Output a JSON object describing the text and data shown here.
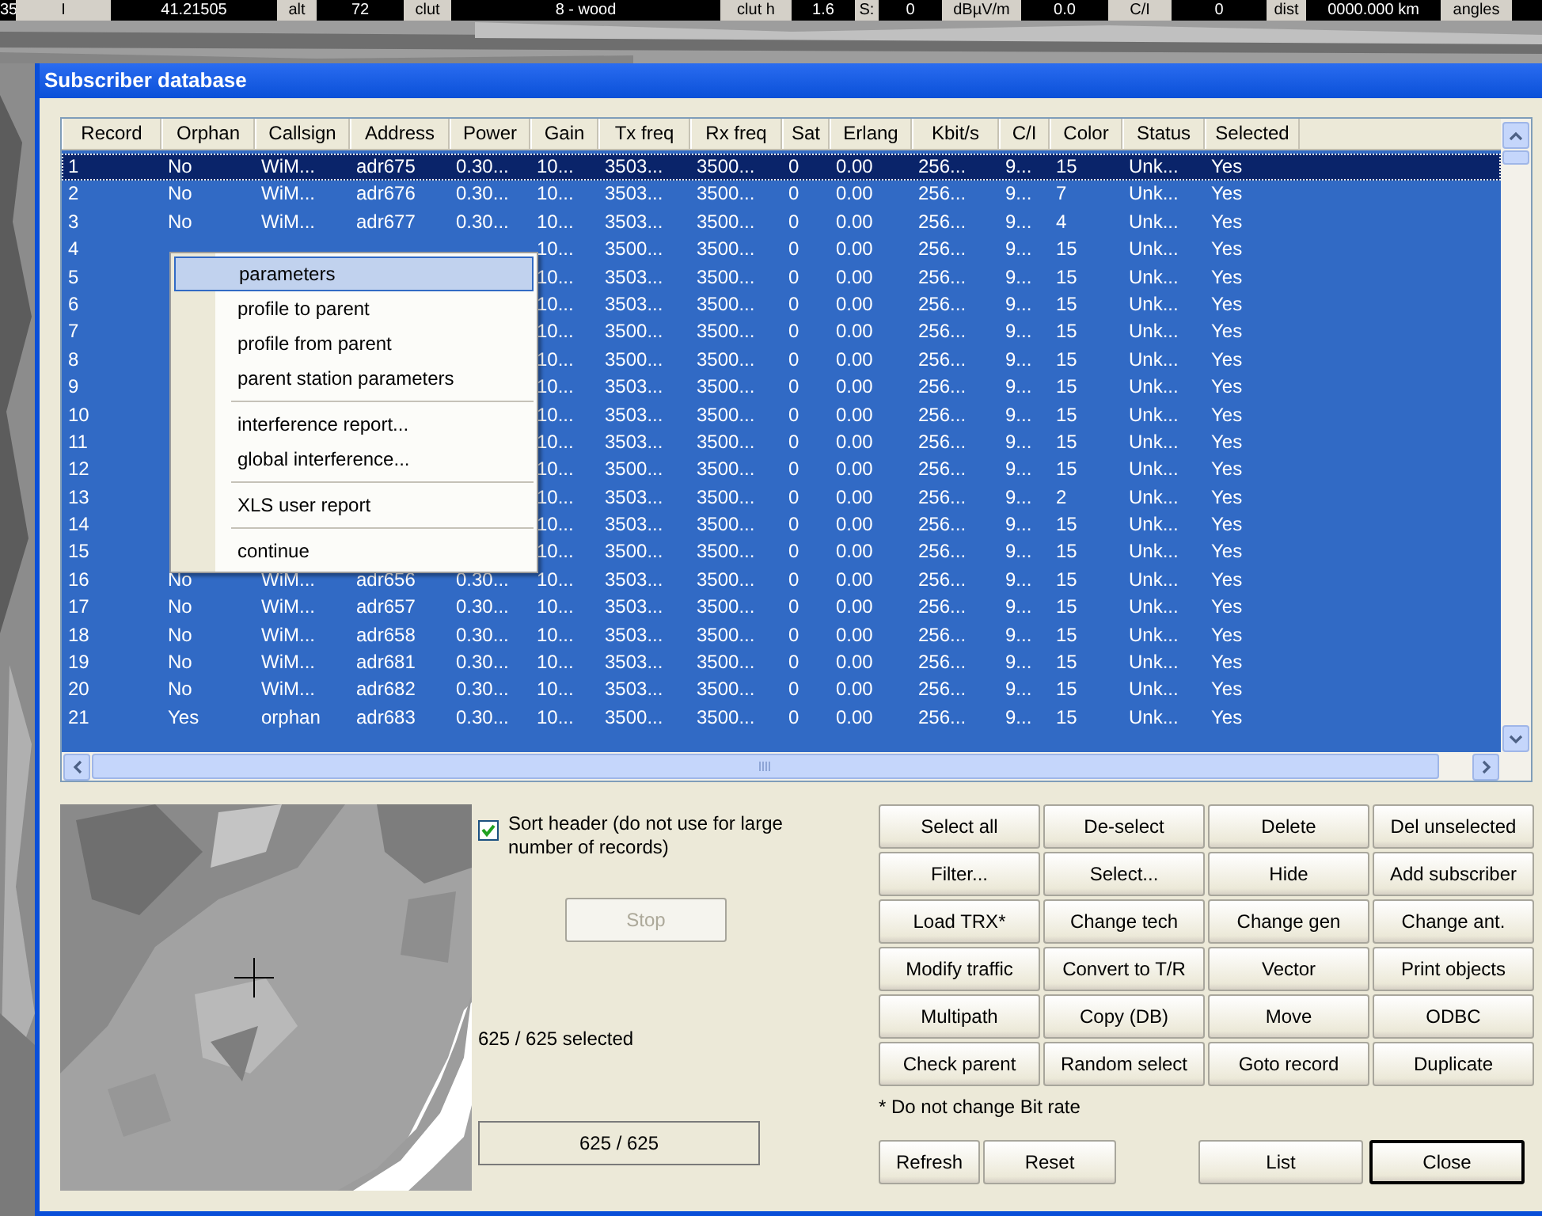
{
  "status_strip": [
    {
      "kind": "value",
      "text": "35"
    },
    {
      "kind": "label",
      "text": "I"
    },
    {
      "kind": "value",
      "text": "41.21505"
    },
    {
      "kind": "label",
      "text": "alt"
    },
    {
      "kind": "value",
      "text": "72"
    },
    {
      "kind": "label",
      "text": "clut"
    },
    {
      "kind": "value",
      "text": "8 - wood"
    },
    {
      "kind": "label",
      "text": "clut h"
    },
    {
      "kind": "value",
      "text": "1.6"
    },
    {
      "kind": "label",
      "text": "S:"
    },
    {
      "kind": "value",
      "text": "0"
    },
    {
      "kind": "label",
      "text": "dBµV/m"
    },
    {
      "kind": "value",
      "text": "0.0"
    },
    {
      "kind": "label",
      "text": "C/I"
    },
    {
      "kind": "value",
      "text": "0"
    },
    {
      "kind": "label",
      "text": "dist"
    },
    {
      "kind": "value",
      "text": "0000.000 km"
    },
    {
      "kind": "label",
      "text": "angles"
    }
  ],
  "window": {
    "title": "Subscriber database"
  },
  "table": {
    "columns": [
      "Record",
      "Orphan",
      "Callsign",
      "Address",
      "Power",
      "Gain",
      "Tx freq",
      "Rx freq",
      "Sat",
      "Erlang",
      "Kbit/s",
      "C/I",
      "Color",
      "Status",
      "Selected"
    ],
    "rows": [
      {
        "focused": true,
        "selected": true,
        "cells": [
          "1",
          "No",
          "WiM...",
          "adr675",
          "0.30...",
          "10...",
          "3503...",
          "3500...",
          "0",
          "0.00",
          "256...",
          "9...",
          "15",
          "Unk...",
          "Yes"
        ]
      },
      {
        "focused": false,
        "selected": true,
        "cells": [
          "2",
          "No",
          "WiM...",
          "adr676",
          "0.30...",
          "10...",
          "3503...",
          "3500...",
          "0",
          "0.00",
          "256...",
          "9...",
          "7",
          "Unk...",
          "Yes"
        ]
      },
      {
        "focused": false,
        "selected": true,
        "cells": [
          "3",
          "No",
          "WiM...",
          "adr677",
          "0.30...",
          "10...",
          "3503...",
          "3500...",
          "0",
          "0.00",
          "256...",
          "9...",
          "4",
          "Unk...",
          "Yes"
        ]
      },
      {
        "focused": false,
        "selected": true,
        "cells": [
          "4",
          null,
          null,
          null,
          null,
          "10...",
          "3500...",
          "3500...",
          "0",
          "0.00",
          "256...",
          "9...",
          "15",
          "Unk...",
          "Yes"
        ]
      },
      {
        "focused": false,
        "selected": true,
        "cells": [
          "5",
          null,
          null,
          null,
          null,
          "10...",
          "3503...",
          "3500...",
          "0",
          "0.00",
          "256...",
          "9...",
          "15",
          "Unk...",
          "Yes"
        ]
      },
      {
        "focused": false,
        "selected": true,
        "cells": [
          "6",
          null,
          null,
          null,
          null,
          "10...",
          "3503...",
          "3500...",
          "0",
          "0.00",
          "256...",
          "9...",
          "15",
          "Unk...",
          "Yes"
        ]
      },
      {
        "focused": false,
        "selected": true,
        "cells": [
          "7",
          null,
          null,
          null,
          null,
          "10...",
          "3500...",
          "3500...",
          "0",
          "0.00",
          "256...",
          "9...",
          "15",
          "Unk...",
          "Yes"
        ]
      },
      {
        "focused": false,
        "selected": true,
        "cells": [
          "8",
          null,
          null,
          null,
          null,
          "10...",
          "3500...",
          "3500...",
          "0",
          "0.00",
          "256...",
          "9...",
          "15",
          "Unk...",
          "Yes"
        ]
      },
      {
        "focused": false,
        "selected": true,
        "cells": [
          "9",
          null,
          null,
          null,
          null,
          "10...",
          "3503...",
          "3500...",
          "0",
          "0.00",
          "256...",
          "9...",
          "15",
          "Unk...",
          "Yes"
        ]
      },
      {
        "focused": false,
        "selected": true,
        "cells": [
          "10",
          null,
          null,
          null,
          null,
          "10...",
          "3503...",
          "3500...",
          "0",
          "0.00",
          "256...",
          "9...",
          "15",
          "Unk...",
          "Yes"
        ]
      },
      {
        "focused": false,
        "selected": true,
        "cells": [
          "11",
          null,
          null,
          null,
          null,
          "10...",
          "3503...",
          "3500...",
          "0",
          "0.00",
          "256...",
          "9...",
          "15",
          "Unk...",
          "Yes"
        ]
      },
      {
        "focused": false,
        "selected": true,
        "cells": [
          "12",
          null,
          null,
          null,
          null,
          "10...",
          "3500...",
          "3500...",
          "0",
          "0.00",
          "256...",
          "9...",
          "15",
          "Unk...",
          "Yes"
        ]
      },
      {
        "focused": false,
        "selected": true,
        "cells": [
          "13",
          null,
          null,
          null,
          null,
          "10...",
          "3503...",
          "3500...",
          "0",
          "0.00",
          "256...",
          "9...",
          "2",
          "Unk...",
          "Yes"
        ]
      },
      {
        "focused": false,
        "selected": true,
        "cells": [
          "14",
          null,
          null,
          null,
          null,
          "10...",
          "3503...",
          "3500...",
          "0",
          "0.00",
          "256...",
          "9...",
          "15",
          "Unk...",
          "Yes"
        ]
      },
      {
        "focused": false,
        "selected": true,
        "cells": [
          "15",
          null,
          null,
          null,
          null,
          "10...",
          "3500...",
          "3500...",
          "0",
          "0.00",
          "256...",
          "9...",
          "15",
          "Unk...",
          "Yes"
        ]
      },
      {
        "focused": false,
        "selected": true,
        "cells": [
          "16",
          "No",
          "WiM...",
          "adr656",
          "0.30...",
          "10...",
          "3503...",
          "3500...",
          "0",
          "0.00",
          "256...",
          "9...",
          "15",
          "Unk...",
          "Yes"
        ]
      },
      {
        "focused": false,
        "selected": true,
        "cells": [
          "17",
          "No",
          "WiM...",
          "adr657",
          "0.30...",
          "10...",
          "3503...",
          "3500...",
          "0",
          "0.00",
          "256...",
          "9...",
          "15",
          "Unk...",
          "Yes"
        ]
      },
      {
        "focused": false,
        "selected": true,
        "cells": [
          "18",
          "No",
          "WiM...",
          "adr658",
          "0.30...",
          "10...",
          "3503...",
          "3500...",
          "0",
          "0.00",
          "256...",
          "9...",
          "15",
          "Unk...",
          "Yes"
        ]
      },
      {
        "focused": false,
        "selected": true,
        "cells": [
          "19",
          "No",
          "WiM...",
          "adr681",
          "0.30...",
          "10...",
          "3503...",
          "3500...",
          "0",
          "0.00",
          "256...",
          "9...",
          "15",
          "Unk...",
          "Yes"
        ]
      },
      {
        "focused": false,
        "selected": true,
        "cells": [
          "20",
          "No",
          "WiM...",
          "adr682",
          "0.30...",
          "10...",
          "3503...",
          "3500...",
          "0",
          "0.00",
          "256...",
          "9...",
          "15",
          "Unk...",
          "Yes"
        ]
      },
      {
        "focused": false,
        "selected": true,
        "cells": [
          "21",
          "Yes",
          "orphan",
          "adr683",
          "0.30...",
          "10...",
          "3500...",
          "3500...",
          "0",
          "0.00",
          "256...",
          "9...",
          "15",
          "Unk...",
          "Yes"
        ]
      }
    ]
  },
  "context_menu": [
    {
      "kind": "item",
      "label": "parameters",
      "selected": true
    },
    {
      "kind": "item",
      "label": "profile to parent",
      "selected": false
    },
    {
      "kind": "item",
      "label": "profile from parent",
      "selected": false
    },
    {
      "kind": "item",
      "label": "parent station parameters",
      "selected": false
    },
    {
      "kind": "separator"
    },
    {
      "kind": "item",
      "label": "interference report...",
      "selected": false
    },
    {
      "kind": "item",
      "label": "global interference...",
      "selected": false
    },
    {
      "kind": "separator"
    },
    {
      "kind": "item",
      "label": "XLS user report",
      "selected": false
    },
    {
      "kind": "separator"
    },
    {
      "kind": "item",
      "label": "continue",
      "selected": false
    }
  ],
  "sort_header": {
    "label": "Sort header (do not use for large number of records)",
    "checked": true
  },
  "stop_button": {
    "label": "Stop",
    "disabled": true
  },
  "selection_count": "625 / 625 selected",
  "record_count": "625 / 625",
  "buttons": [
    "Select all",
    "De-select",
    "Delete",
    "Del unselected",
    "Filter...",
    "Select...",
    "Hide",
    "Add subscriber",
    "Load TRX*",
    "Change tech",
    "Change gen",
    "Change ant.",
    "Modify traffic",
    "Convert to T/R",
    "Vector",
    "Print objects",
    "Multipath",
    "Copy (DB)",
    "Move",
    "ODBC",
    "Check parent",
    "Random select",
    "Goto record",
    "Duplicate"
  ],
  "note": "* Do not change Bit rate",
  "footer_buttons": [
    {
      "label": "Refresh",
      "default": false
    },
    {
      "label": "Reset",
      "default": false
    },
    {
      "label": "List",
      "default": false
    },
    {
      "label": "Close",
      "default": true
    }
  ]
}
